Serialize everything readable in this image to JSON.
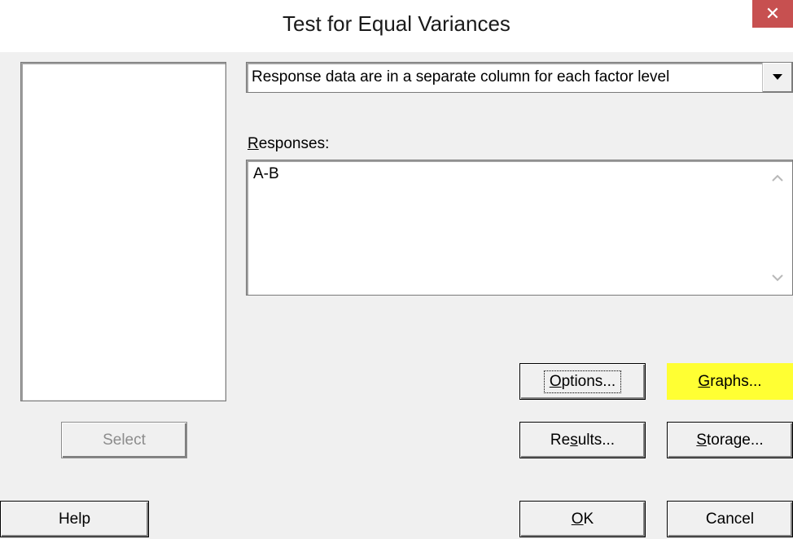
{
  "window": {
    "title": "Test for Equal Variances",
    "close_glyph": "✕"
  },
  "variables_list": {
    "items": []
  },
  "data_layout": {
    "selected": "Response data are in a separate column for each factor level"
  },
  "responses": {
    "label_mnemonic": "R",
    "label_rest": "esponses:",
    "value": "A-B"
  },
  "buttons": {
    "select": "Select",
    "help": "Help",
    "options_mnemonic": "O",
    "options_rest": "ptions...",
    "graphs_mnemonic": "G",
    "graphs_rest": "raphs...",
    "results_pre": "Re",
    "results_mnemonic": "s",
    "results_rest": "ults...",
    "storage_mnemonic": "S",
    "storage_rest": "torage...",
    "ok_mnemonic": "O",
    "ok_rest": "K",
    "cancel": "Cancel"
  },
  "colors": {
    "highlight": "#ffff33",
    "close_button": "#c75050"
  }
}
